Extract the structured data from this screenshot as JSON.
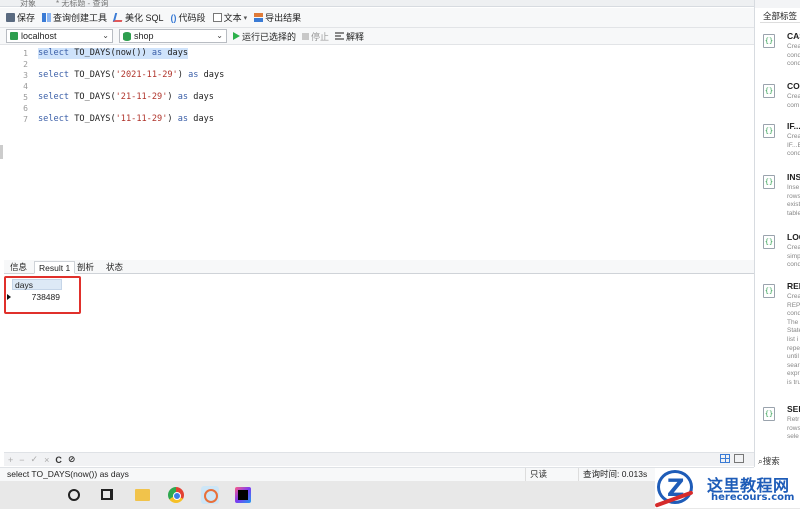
{
  "tabs": {
    "left_label": "对象",
    "query_label": "* 无标题 - 查询"
  },
  "toolbar": {
    "save": "保存",
    "query_builder": "查询创建工具",
    "beautify": "美化 SQL",
    "snippet": "代码段",
    "text": "文本",
    "export": "导出结果"
  },
  "connection": {
    "host": "localhost",
    "database": "shop",
    "run_selected": "运行已选择的",
    "stop": "停止",
    "explain": "解释"
  },
  "editor": {
    "lines": [
      {
        "n": "1",
        "kw1": "select",
        "fn": " TO_DAYS(now()) ",
        "kw2": "as",
        "alias": " days",
        "str": "",
        "selected": true
      },
      {
        "n": "2"
      },
      {
        "n": "3",
        "kw1": "select",
        "fn": " TO_DAYS(",
        "str": "'2021-11-29'",
        "fn2": ") ",
        "kw2": "as",
        "alias": " days"
      },
      {
        "n": "4"
      },
      {
        "n": "5",
        "kw1": "select",
        "fn": " TO_DAYS(",
        "str": "'21-11-29'",
        "fn2": ") ",
        "kw2": "as",
        "alias": " days"
      },
      {
        "n": "6"
      },
      {
        "n": "7",
        "kw1": "select",
        "fn": " TO_DAYS(",
        "str": "'11-11-29'",
        "fn2": ") ",
        "kw2": "as",
        "alias": " days"
      }
    ]
  },
  "result_tabs": [
    {
      "label": "信息",
      "active": false
    },
    {
      "label": "Result 1",
      "active": true
    },
    {
      "label": "剖析",
      "active": false
    },
    {
      "label": "状态",
      "active": false
    }
  ],
  "result": {
    "column": "days",
    "rows": [
      "738489"
    ]
  },
  "gridbar": {
    "add": "+",
    "remove": "−",
    "apply": "✓",
    "discard": "×",
    "refresh": "C",
    "stop": "⊘"
  },
  "status": {
    "query": "select TO_DAYS(now()) as days",
    "readonly": "只读",
    "time": "查询时间: 0.013s"
  },
  "right_panel": {
    "tab": "全部标签",
    "snippets": [
      {
        "title": "CASE",
        "desc": "Crea\ncond\ncond"
      },
      {
        "title": "CON",
        "desc": "Crea\ncom"
      },
      {
        "title": "IF...",
        "desc": "Crea\nIF...E\ncond"
      },
      {
        "title": "INSE",
        "desc": "Inse\nrows\nexist\ntable"
      },
      {
        "title": "LOO",
        "desc": "Crea\nsimp\ncond"
      },
      {
        "title": "REP",
        "desc": "Crea\nREP\ncond\nThe\nState\nlist i\nrepe\nuntil\nsear\nexpr\nis tru"
      },
      {
        "title": "SELE",
        "desc": "Retr\nrows\nsele"
      }
    ],
    "search": "搜索"
  },
  "watermark": {
    "title": "这里教程网",
    "url": "herecours.com"
  }
}
